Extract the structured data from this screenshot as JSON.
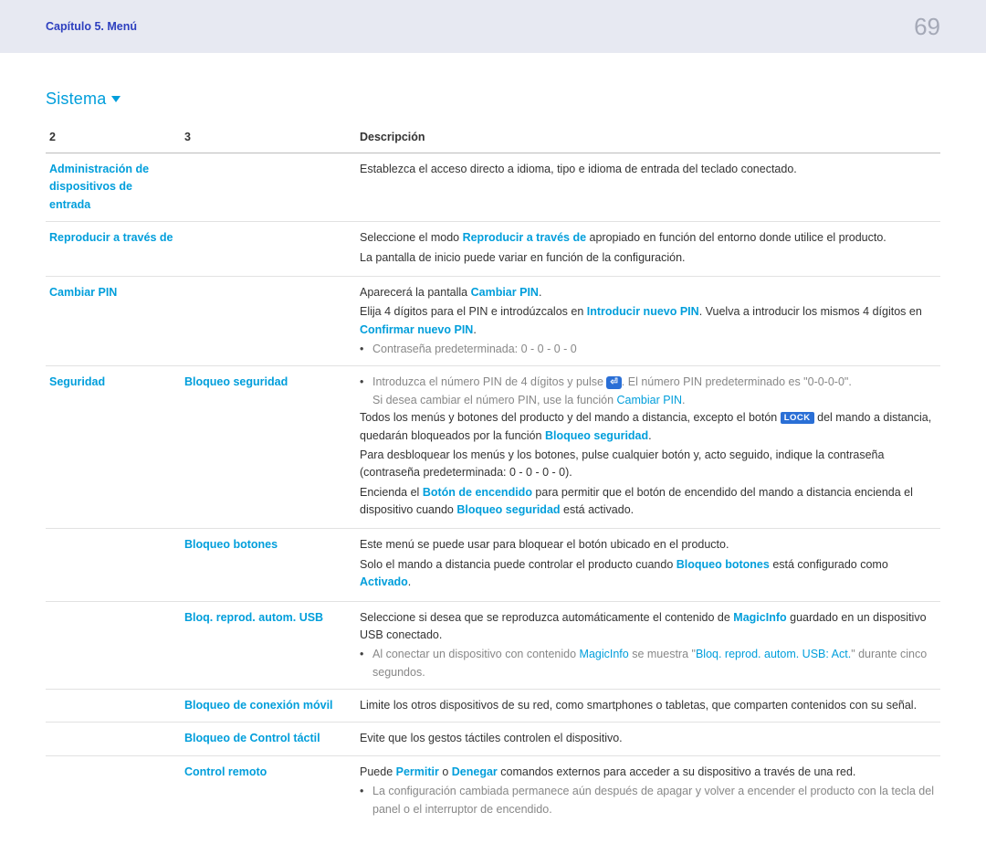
{
  "header": {
    "chapter": "Capítulo 5. Menú",
    "page": "69"
  },
  "section": "Sistema",
  "thead": {
    "c1": "2",
    "c2": "3",
    "c3": "Descripción"
  },
  "rows": {
    "admin": {
      "c1": "Administración de dispositivos de entrada",
      "desc": "Establezca el acceso directo a idioma, tipo e idioma de entrada del teclado conectado."
    },
    "repro": {
      "c1": "Reproducir a través de",
      "d1a": "Seleccione el modo ",
      "d1b": "Reproducir a través de",
      "d1c": " apropiado en función del entorno donde utilice el producto.",
      "d2": "La pantalla de inicio puede variar en función de la configuración."
    },
    "pin": {
      "c1": "Cambiar PIN",
      "d1a": "Aparecerá la pantalla ",
      "d1b": "Cambiar PIN",
      "d1c": ".",
      "d2a": "Elija 4 dígitos para el PIN e introdúzcalos en ",
      "d2b": "Introducir nuevo PIN",
      "d2c": ". Vuelva a introducir los mismos 4 dígitos en ",
      "d2d": "Confirmar nuevo PIN",
      "d2e": ".",
      "bull1": "Contraseña predeterminada: 0 - 0 - 0 - 0"
    },
    "seg": {
      "c1": "Seguridad",
      "c2": "Bloqueo seguridad",
      "n1a": "Introduzca el número PIN de 4 dígitos y pulse ",
      "n1_enter": "⏎",
      "n1b": ". El número PIN predeterminado es \"0-0-0-0\".",
      "n2a": "Si desea cambiar el número PIN, use la función ",
      "n2b": "Cambiar PIN",
      "n2c": ".",
      "p1a": "Todos los menús y botones del producto y del mando a distancia, excepto el botón ",
      "p1_lock": "LOCK",
      "p1b": " del mando a distancia, quedarán bloqueados por la función ",
      "p1c": "Bloqueo seguridad",
      "p1d": ".",
      "p2": "Para desbloquear los menús y los botones, pulse cualquier botón y, acto seguido, indique la contraseña (contraseña predeterminada: 0 - 0 - 0 - 0).",
      "p3a": "Encienda el ",
      "p3b": "Botón de encendido",
      "p3c": " para permitir que el botón de encendido del mando a distancia encienda el dispositivo cuando ",
      "p3d": "Bloqueo seguridad",
      "p3e": " está activado."
    },
    "bbot": {
      "c2": "Bloqueo botones",
      "p1": "Este menú se puede usar para bloquear el botón ubicado en el producto.",
      "p2a": "Solo el mando a distancia puede controlar el producto cuando ",
      "p2b": "Bloqueo botones",
      "p2c": " está configurado como ",
      "p2d": "Activado",
      "p2e": "."
    },
    "busb": {
      "c2": "Bloq. reprod. autom. USB",
      "p1a": "Seleccione si desea que se reproduzca automáticamente el contenido de ",
      "p1b": "MagicInfo",
      "p1c": " guardado en un dispositivo USB conectado.",
      "b1a": "Al conectar un dispositivo con contenido ",
      "b1b": "MagicInfo",
      "b1c": " se muestra \"",
      "b1d": "Bloq. reprod. autom. USB: Act.",
      "b1e": "\" durante cinco segundos."
    },
    "bmov": {
      "c2": "Bloqueo de conexión móvil",
      "desc": "Limite los otros dispositivos de su red, como smartphones o tabletas, que comparten contenidos con su señal."
    },
    "btac": {
      "c2": "Bloqueo de Control táctil",
      "desc": "Evite que los gestos táctiles controlen el dispositivo."
    },
    "crem": {
      "c2": "Control remoto",
      "p1a": "Puede ",
      "p1b": "Permitir",
      "p1c": " o ",
      "p1d": "Denegar",
      "p1e": " comandos externos para acceder a su dispositivo a través de una red.",
      "b1": "La configuración cambiada permanece aún después de apagar y volver a encender el producto con la tecla del panel o el interruptor de encendido."
    }
  }
}
